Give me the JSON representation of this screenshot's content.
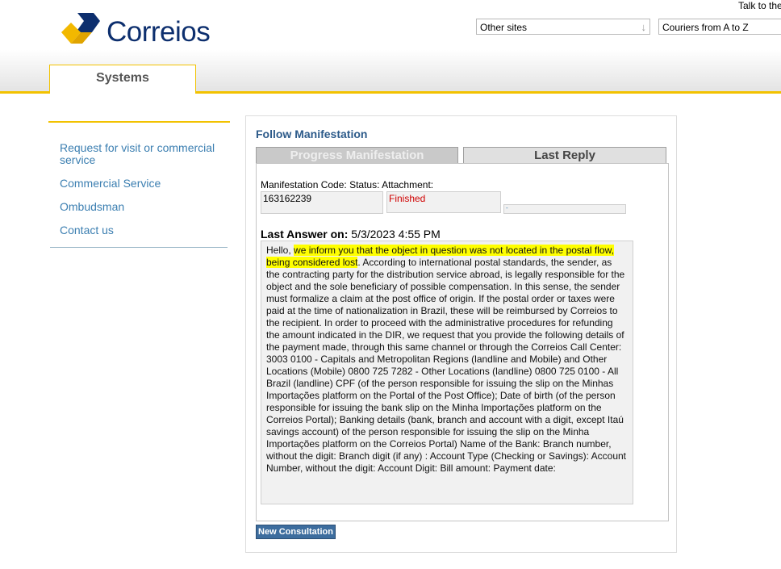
{
  "header": {
    "logo_text": "Correios",
    "talk_link": "Talk to the",
    "other_sites": "Other sites",
    "couriers": "Couriers from A to Z",
    "systems_tab": "Systems"
  },
  "sidebar": {
    "items": [
      {
        "label": "Request for visit or commercial service"
      },
      {
        "label": "Commercial Service"
      },
      {
        "label": "Ombudsman"
      },
      {
        "label": "Contact us"
      }
    ]
  },
  "main": {
    "title": "Follow Manifestation",
    "tabs": [
      {
        "label": "Progress Manifestation"
      },
      {
        "label": "Last Reply"
      }
    ],
    "fields_label": "Manifestation Code: Status: Attachment:",
    "code": "163162239",
    "status": "Finished",
    "attachment": "-",
    "last_answer_label": "Last Answer on:",
    "last_answer_date": "5/3/2023 4:55 PM",
    "answer_prefix": "Hello,",
    "answer_highlight": "we inform you that the object in question was not located in the postal flow, being considered lost",
    "answer_rest": ". According to international postal standards, the sender, as the contracting party for the distribution service abroad, is legally responsible for the object and the sole beneficiary of possible compensation. In this sense, the sender must formalize a claim at the post office of origin. If the postal order or taxes were paid at the time of nationalization in Brazil, these will be reimbursed by Correios to the recipient. In order to proceed with the administrative procedures for refunding the amount indicated in the DIR, we request that you provide the following details of the payment made, through this same channel or through the Correios Call Center: 3003 0100 - Capitals and Metropolitan Regions (landline and Mobile) and Other Locations (Mobile) 0800 725 7282 - Other Locations (landline) 0800 725 0100 - All Brazil (landline) CPF (of the person responsible for issuing the slip on the Minhas Importações platform on the Portal of the Post Office); Date of birth (of the person responsible for issuing the bank slip on the Minha Importações platform on the Correios Portal); Banking details (bank, branch and account with a digit, except Itaú savings account) of the person responsible for issuing the slip on the Minha Importações platform on the Correios Portal) Name of the Bank: Branch number, without the digit: Branch digit (if any) : Account Type (Checking or Savings): Account Number, without the digit: Account Digit: Bill amount: Payment date:",
    "new_consultation": "New Consultation"
  },
  "colors": {
    "accent_yellow": "#f2c200",
    "link_blue": "#3c7fb1",
    "brand_navy": "#0d2f6e",
    "status_red": "#d00000",
    "button_blue": "#3d6d9e"
  }
}
